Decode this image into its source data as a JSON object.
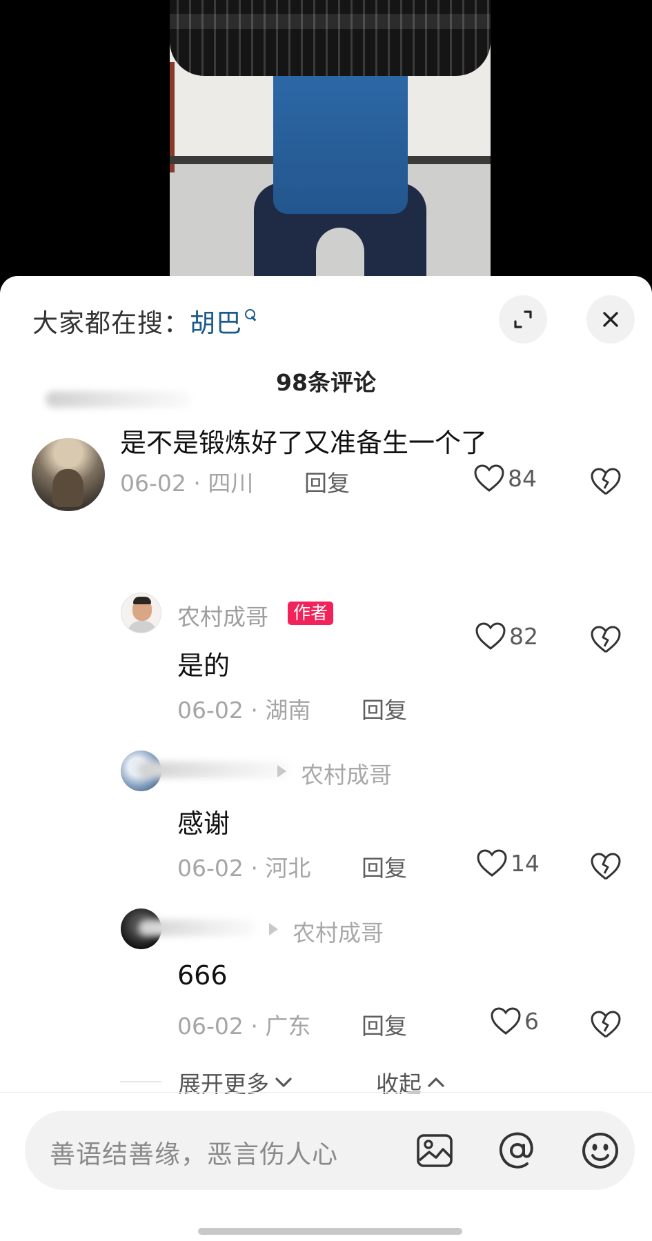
{
  "header": {
    "search_label": "大家都在搜：",
    "search_term": "胡巴"
  },
  "comment_count": "98条评论",
  "comments": [
    {
      "username": "",
      "text": "是不是锻炼好了又准备生一个了",
      "date_location": "06-02 · 四川",
      "reply_label": "回复",
      "likes": "84"
    },
    {
      "username": "农村成哥",
      "badge": "作者",
      "text": "是的",
      "date_location": "06-02 · 湖南",
      "reply_label": "回复",
      "likes": "82"
    },
    {
      "username": "",
      "reply_to": "农村成哥",
      "text": "感谢",
      "date_location": "06-02 · 河北",
      "reply_label": "回复",
      "likes": "14"
    },
    {
      "username": "",
      "reply_to": "农村成哥",
      "text": "666",
      "date_location": "06-02 · 广东",
      "reply_label": "回复",
      "likes": "6"
    }
  ],
  "thread_controls": {
    "expand_more": "展开更多",
    "collapse": "收起"
  },
  "input": {
    "placeholder": "善语结善缘，恶言伤人心"
  },
  "icons": {
    "search": "search-icon",
    "expand": "expand-icon",
    "close": "close-icon",
    "like": "heart-icon",
    "dislike": "broken-heart-icon",
    "image": "image-icon",
    "mention": "at-icon",
    "emoji": "emoji-icon"
  },
  "colors": {
    "search_term": "#1b5a8a",
    "author_badge": "#f2235a"
  }
}
